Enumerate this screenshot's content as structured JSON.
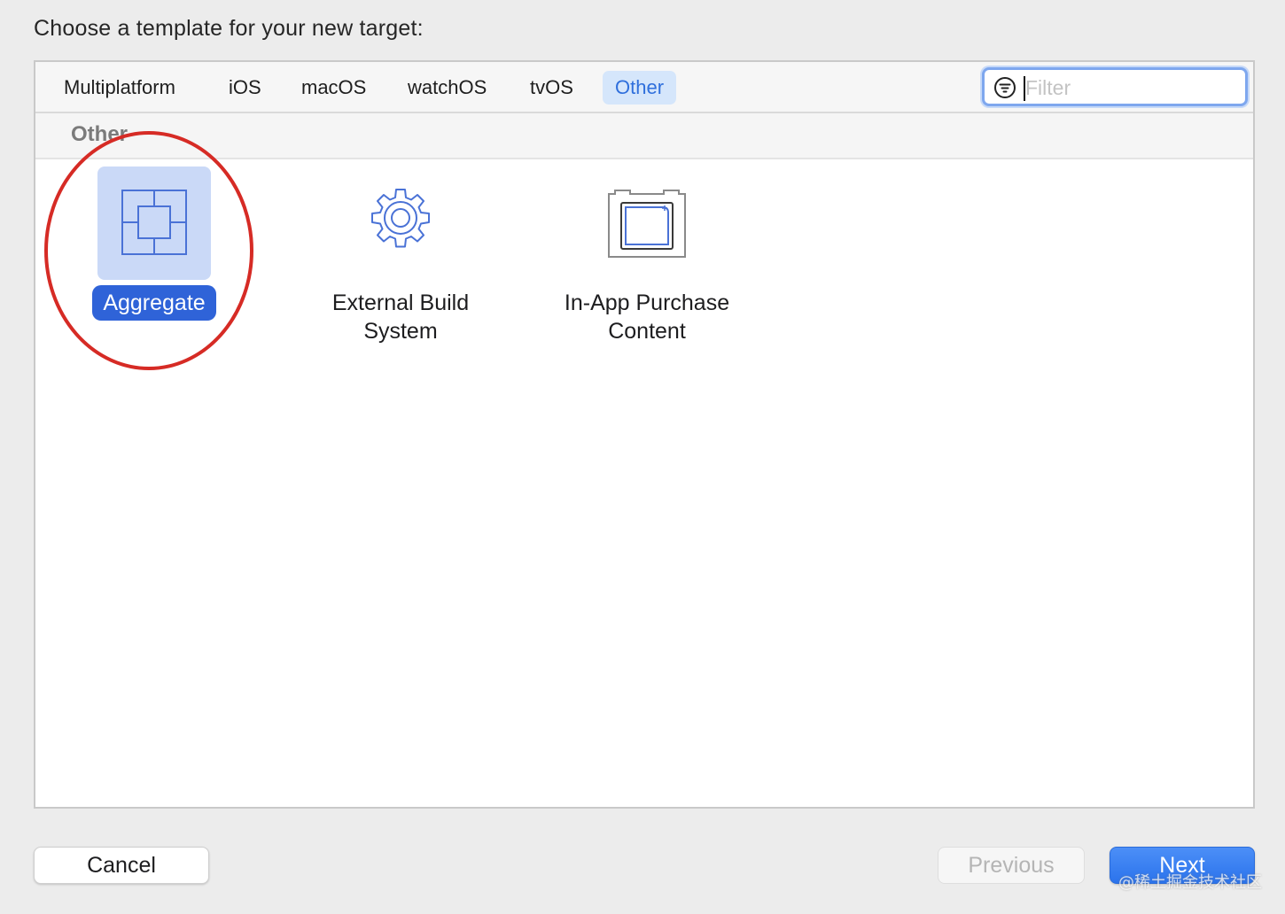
{
  "prompt": "Choose a template for your new target:",
  "tabs": [
    {
      "label": "Multiplatform",
      "active": false
    },
    {
      "label": "iOS",
      "active": false
    },
    {
      "label": "macOS",
      "active": false
    },
    {
      "label": "watchOS",
      "active": false
    },
    {
      "label": "tvOS",
      "active": false
    },
    {
      "label": "Other",
      "active": true
    }
  ],
  "filter": {
    "placeholder": "Filter",
    "value": "",
    "icon": "filter-icon"
  },
  "section": {
    "title": "Other"
  },
  "templates": [
    {
      "label": "Aggregate",
      "icon": "aggregate-icon",
      "selected": true
    },
    {
      "label": "External Build\nSystem",
      "icon": "gear-icon",
      "selected": false
    },
    {
      "label": "In-App Purchase\nContent",
      "icon": "in-app-purchase-icon",
      "selected": false
    }
  ],
  "buttons": {
    "cancel": "Cancel",
    "previous": "Previous",
    "next": "Next"
  },
  "watermark": "@稀土掘金技术社区",
  "colors": {
    "accent": "#2f63d8",
    "active_tab_bg": "#d5e6fb",
    "active_tab_text": "#2f6fdc",
    "icon_stroke": "#4a72d6",
    "annotation": "#d62b25"
  }
}
